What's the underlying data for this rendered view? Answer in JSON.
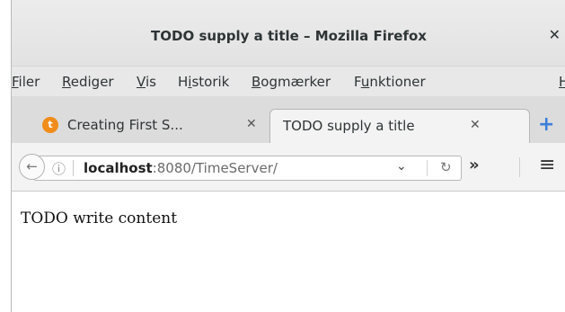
{
  "window": {
    "title": "TODO supply a title – Mozilla Firefox",
    "close_glyph": "✕"
  },
  "menubar": {
    "items": [
      {
        "mnemonic": "F",
        "rest": "iler"
      },
      {
        "mnemonic": "R",
        "rest": "ediger"
      },
      {
        "mnemonic": "V",
        "rest": "is"
      },
      {
        "lead": "H",
        "mnemonic": "i",
        "rest": "storik"
      },
      {
        "mnemonic": "B",
        "rest": "ogmærker"
      },
      {
        "lead": "F",
        "mnemonic": "u",
        "rest": "nktioner"
      },
      {
        "mnemonic": "H",
        "rest": ""
      }
    ]
  },
  "tabs": [
    {
      "label": "Creating First S...",
      "icon_letter": "t",
      "close": "✕",
      "active": false
    },
    {
      "label": "TODO supply a title",
      "close": "✕",
      "active": true
    }
  ],
  "newtab": {
    "glyph": "+"
  },
  "navbar": {
    "back_glyph": "←",
    "globe_glyph": "ⓘ",
    "url_host": "localhost",
    "url_rest": ":8080/TimeServer/",
    "dropdown_glyph": "⌄",
    "reload_glyph": "↻",
    "overflow_glyph": "»",
    "menu_glyph": "≡"
  },
  "content": {
    "text": "TODO write content"
  },
  "colors": {
    "tab_icon": "#f08c1a",
    "newtab_plus": "#3b7fd9"
  }
}
